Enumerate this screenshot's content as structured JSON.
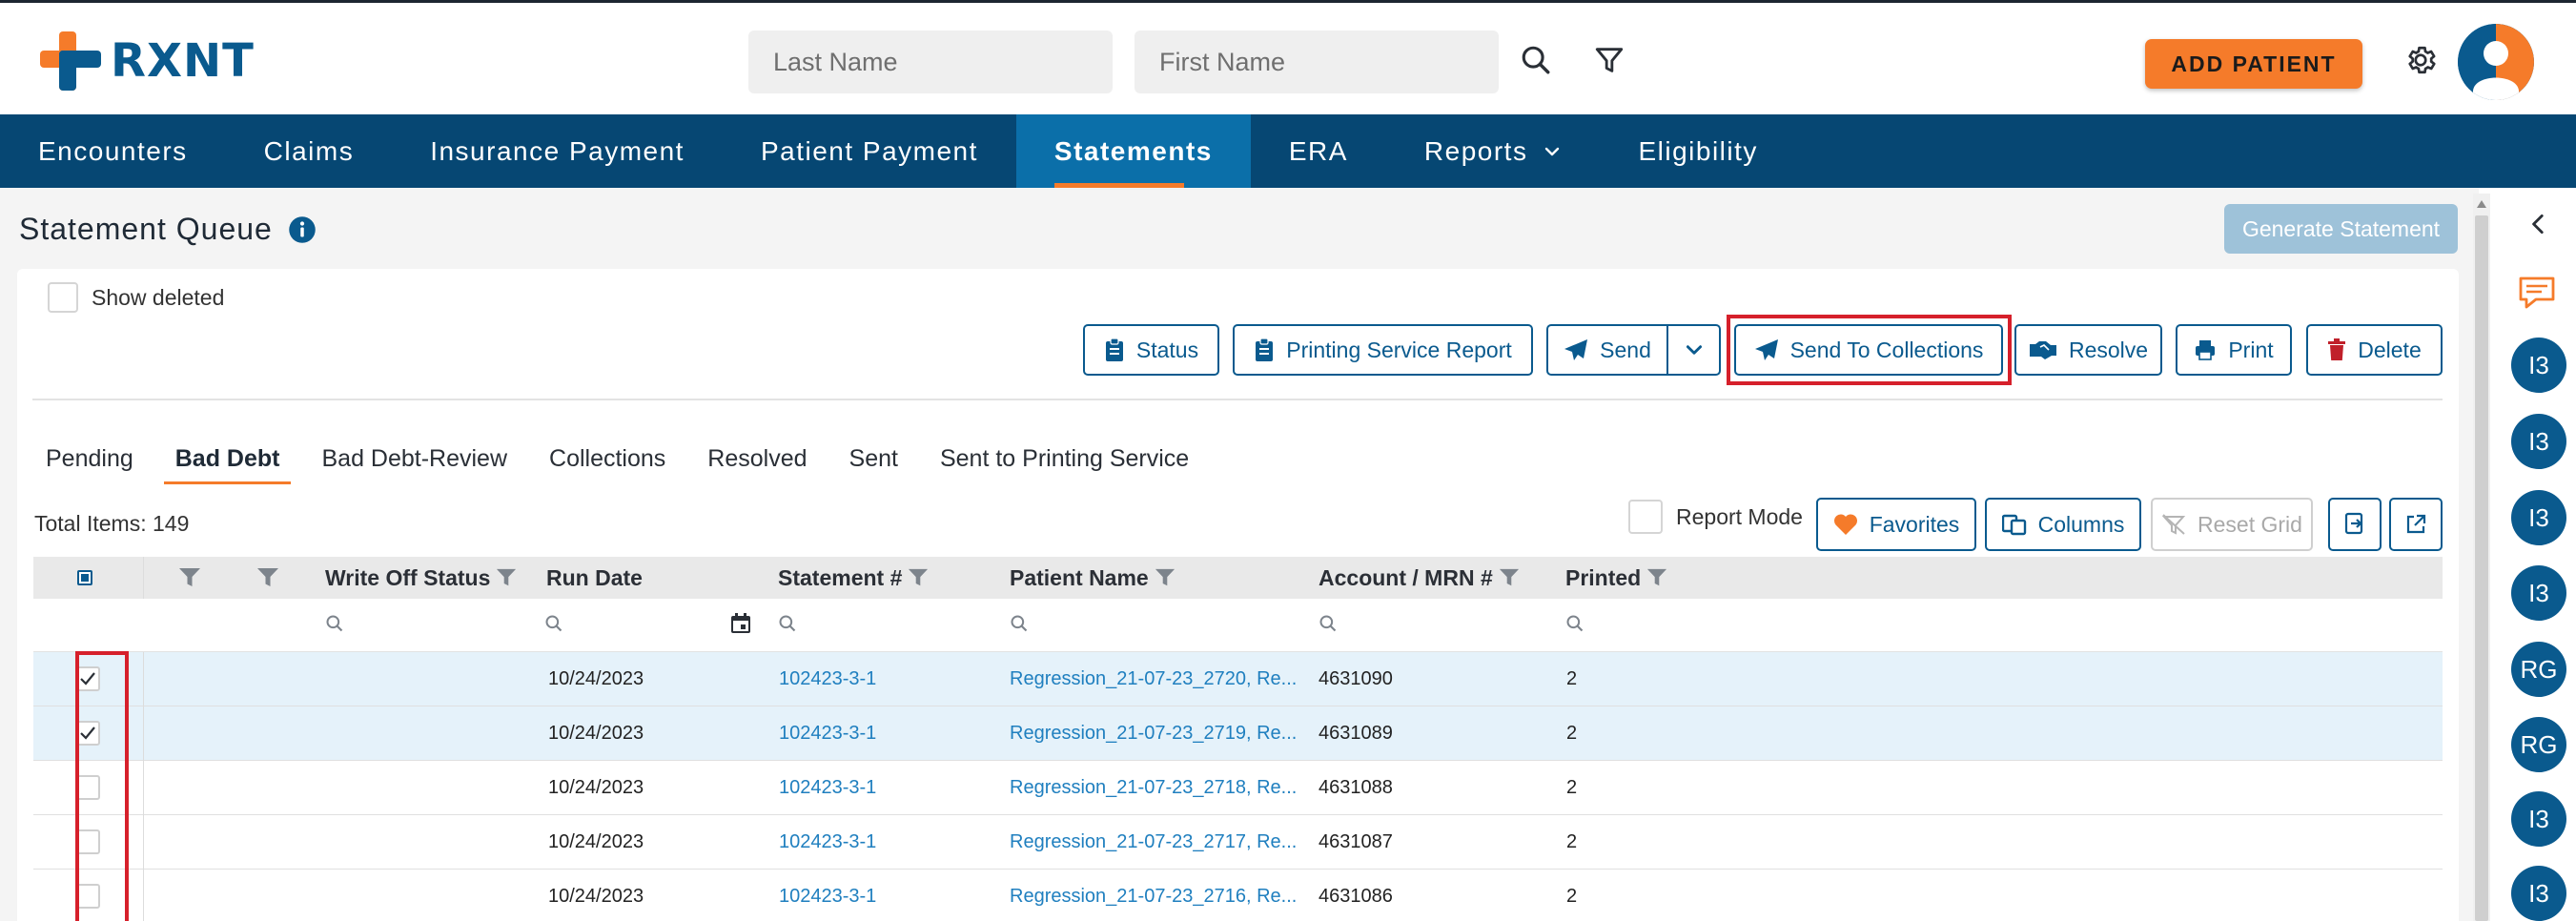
{
  "app": {
    "logo_text": "RXNT",
    "colors": {
      "brand": "#0a5a8e",
      "nav": "#064773",
      "nav_active": "#0b6fa9",
      "accent": "#f57b2a",
      "highlight": "#d6202b"
    }
  },
  "header": {
    "last_name_placeholder": "Last Name",
    "first_name_placeholder": "First Name",
    "add_patient_label": "ADD PATIENT",
    "icons": [
      "search-icon",
      "filter-icon",
      "gear-icon",
      "user-avatar"
    ]
  },
  "nav": {
    "items": [
      {
        "label": "Encounters"
      },
      {
        "label": "Claims"
      },
      {
        "label": "Insurance Payment"
      },
      {
        "label": "Patient Payment"
      },
      {
        "label": "Statements",
        "active": true
      },
      {
        "label": "ERA"
      },
      {
        "label": "Reports",
        "dropdown": true
      },
      {
        "label": "Eligibility"
      }
    ]
  },
  "page": {
    "title": "Statement Queue",
    "generate_statement_label": "Generate Statement",
    "show_deleted_label": "Show deleted"
  },
  "actions": {
    "status": "Status",
    "printing_service_report": "Printing Service Report",
    "send": "Send",
    "send_to_collections": "Send To Collections",
    "resolve": "Resolve",
    "print": "Print",
    "delete": "Delete"
  },
  "tabs": {
    "items": [
      {
        "label": "Pending"
      },
      {
        "label": "Bad Debt",
        "active": true
      },
      {
        "label": "Bad Debt-Review"
      },
      {
        "label": "Collections"
      },
      {
        "label": "Resolved"
      },
      {
        "label": "Sent"
      },
      {
        "label": "Sent to Printing Service"
      }
    ]
  },
  "grid_toolbar": {
    "total_items": "Total Items: 149",
    "report_mode_label": "Report Mode",
    "favorites": "Favorites",
    "columns": "Columns",
    "reset_grid": "Reset Grid"
  },
  "grid": {
    "headers": {
      "write_off_status": "Write Off Status",
      "run_date": "Run Date",
      "statement_no": "Statement #",
      "patient_name": "Patient Name",
      "account_mrn": "Account / MRN #",
      "printed": "Printed"
    },
    "rows": [
      {
        "checked": true,
        "run_date": "10/24/2023",
        "statement_no": "102423-3-1",
        "patient_name": "Regression_21-07-23_2720, Re...",
        "account": "4631090",
        "printed": "2"
      },
      {
        "checked": true,
        "run_date": "10/24/2023",
        "statement_no": "102423-3-1",
        "patient_name": "Regression_21-07-23_2719, Re...",
        "account": "4631089",
        "printed": "2"
      },
      {
        "checked": false,
        "run_date": "10/24/2023",
        "statement_no": "102423-3-1",
        "patient_name": "Regression_21-07-23_2718, Re...",
        "account": "4631088",
        "printed": "2"
      },
      {
        "checked": false,
        "run_date": "10/24/2023",
        "statement_no": "102423-3-1",
        "patient_name": "Regression_21-07-23_2717, Re...",
        "account": "4631087",
        "printed": "2"
      },
      {
        "checked": false,
        "run_date": "10/24/2023",
        "statement_no": "102423-3-1",
        "patient_name": "Regression_21-07-23_2716, Re...",
        "account": "4631086",
        "printed": "2"
      }
    ]
  },
  "rail": {
    "avatars": [
      "I3",
      "I3",
      "I3",
      "I3",
      "RG",
      "RG",
      "I3",
      "I3"
    ]
  }
}
